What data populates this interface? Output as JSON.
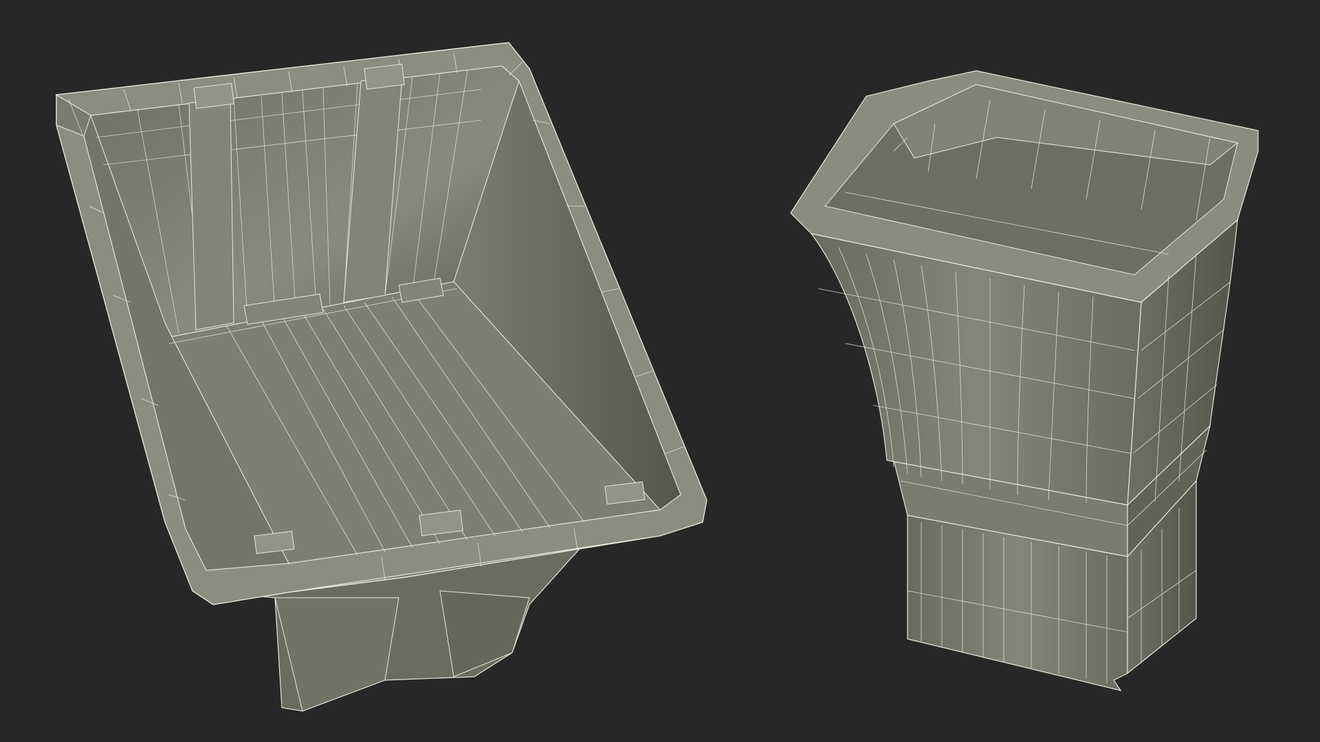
{
  "scene": {
    "background_color": "#272727",
    "surface_color": "#7f7f72",
    "surface_dark": "#5d5d54",
    "surface_light": "#9a9a8c",
    "wire_color": "#e8e8dc",
    "objects": [
      {
        "name": "crate",
        "view": "top-angled"
      },
      {
        "name": "bin",
        "view": "three-quarter"
      }
    ]
  }
}
